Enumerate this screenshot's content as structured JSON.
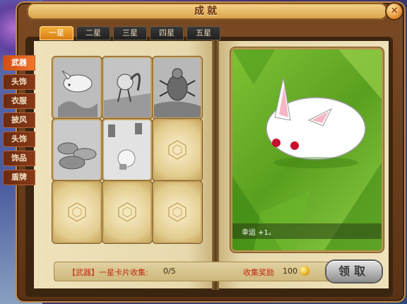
{
  "window": {
    "title": "成就",
    "close_glyph": "✕"
  },
  "star_tabs": [
    {
      "label": "一星",
      "active": true
    },
    {
      "label": "二星",
      "active": false
    },
    {
      "label": "三星",
      "active": false
    },
    {
      "label": "四星",
      "active": false
    },
    {
      "label": "五星",
      "active": false
    }
  ],
  "categories": [
    {
      "label": "武器",
      "active": true
    },
    {
      "label": "头饰",
      "active": false
    },
    {
      "label": "衣服",
      "active": false
    },
    {
      "label": "披风",
      "active": false
    },
    {
      "label": "头饰",
      "active": false
    },
    {
      "label": "饰品",
      "active": false
    },
    {
      "label": "盾牌",
      "active": false
    }
  ],
  "cards": [
    {
      "state": "filled",
      "icon": "white-rabbit-icon"
    },
    {
      "state": "filled",
      "icon": "squirrel-creature-icon"
    },
    {
      "state": "filled",
      "icon": "beetle-icon"
    },
    {
      "state": "filled",
      "icon": "bread-pile-icon"
    },
    {
      "state": "filled",
      "icon": "potion-scene-icon"
    },
    {
      "state": "empty",
      "icon": "hexagon-emblem-icon"
    },
    {
      "state": "empty",
      "icon": "hexagon-emblem-icon"
    },
    {
      "state": "empty",
      "icon": "hexagon-emblem-icon"
    },
    {
      "state": "empty",
      "icon": "hexagon-emblem-icon"
    }
  ],
  "preview": {
    "creature": "white-rabbit-icon",
    "caption": "幸运 +1。"
  },
  "footer": {
    "progress_label": "【武器】一星卡片收集:",
    "progress_value": "0/5",
    "reward_label": "收集奖励",
    "reward_value": "100",
    "reward_icon": "gold-coin-icon",
    "claim_label": "领取"
  },
  "colors": {
    "accent": "#f0782a",
    "title": "#6a2e08",
    "highlight": "#c22a10"
  }
}
